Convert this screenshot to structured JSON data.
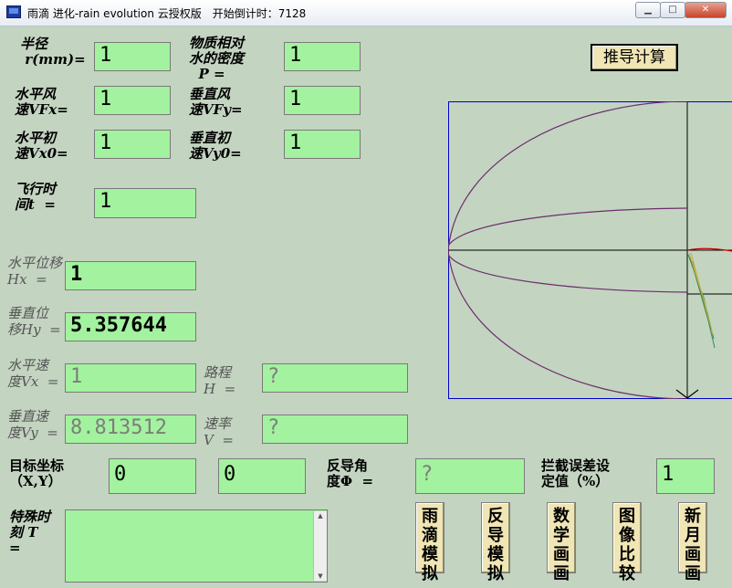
{
  "window": {
    "title": "雨滴 进化-rain evolution 云授权版　开始倒计时：7128"
  },
  "buttons": {
    "calculate": "推导计算",
    "raindrop_sim": "雨\n滴\n模\n拟",
    "reverse_sim": "反\n导\n模\n拟",
    "math_draw": "数\n学\n画\n画",
    "image_compare": "图\n像\n比\n较",
    "new_moon": "新\n月\n画\n画"
  },
  "labels": {
    "radius": "半径\n r(mm)=",
    "density": "物质相对\n水的密度\n  P =",
    "vfx": "水平风\n速VFx=",
    "vfy": "垂直风\n速VFy=",
    "vx0": "水平初\n速Vx0=",
    "vy0": "垂直初\n速Vy0=",
    "time": "飞行时\n间t  =",
    "hx": "水平位移\nHx  =",
    "hy": "垂直位\n移Hy  =",
    "vx": "水平速\n度Vx  =",
    "vy": "垂直速\n度Vy  =",
    "path": "路程\nH  =",
    "speed": "速率\nV  =",
    "target": "目标坐标\n（X,Y）",
    "angle": "反导角\n度Φ  =",
    "error": "拦截误差设\n定值（%）",
    "special": "特殊时\n刻 T\n="
  },
  "values": {
    "radius": "1",
    "density": "1",
    "vfx": "1",
    "vfy": "1",
    "vx0": "1",
    "vy0": "1",
    "time": "1",
    "hx": "1",
    "hy": "5.357644",
    "vx": "1",
    "vy": "8.813512",
    "path": "?",
    "speed": "?",
    "target_x": "0",
    "target_y": "0",
    "angle": "?",
    "error": "1",
    "special": ""
  },
  "colors": {
    "background": "#c3d4c1",
    "field": "#a3f29f",
    "button": "#f0e5b4",
    "plot_frame": "#0000cc",
    "curve": "#6b2d6b",
    "trajectory": "#cc0000"
  }
}
